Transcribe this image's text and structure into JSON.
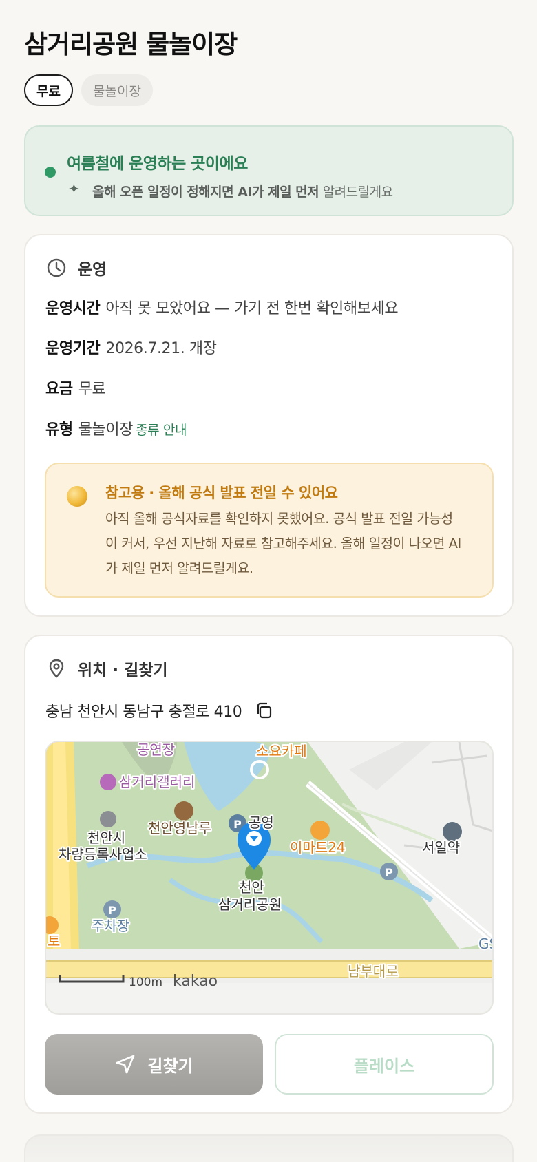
{
  "header": {
    "title": "삼거리공원 물놀이장"
  },
  "tags": {
    "price": "무료",
    "type": "물놀이장"
  },
  "notice": {
    "title": "여름철에 운영하는 곳이에요",
    "sub_bold": "올해 오픈 일정이 정해지면 AI가 제일 먼저",
    "sub_rest": " 알려드릴게요",
    "accent_color": "#2b7f55"
  },
  "operation": {
    "section_title": "운영",
    "hours_label": "운영시간",
    "hours_value": "아직 못 모았어요 — 가기 전 한번 확인해보세요",
    "period_label": "운영기간",
    "period_value": "2026.7.21. 개장",
    "fee_label": "요금",
    "fee_value": "무료",
    "type_label": "유형",
    "type_value": "물놀이장",
    "type_link": "종류 안내",
    "warning": {
      "title": "참고용 · 올해 공식 발표 전일 수 있어요",
      "body": "아직 올해 공식자료를 확인하지 못했어요. 공식 발표 전일 가능성이 커서, 우선 지난해 자료로 참고해주세요. 올해 일정이 나오면 AI가 제일 먼저 알려드릴게요."
    }
  },
  "location": {
    "section_title": "위치 · 길찾기",
    "address": "충남 천안시 동남구 충절로 410",
    "map": {
      "labels": {
        "theater": "공연장",
        "cafe": "소요카페",
        "gallery": "삼거리갤러리",
        "pavilion": "천안영남루",
        "registry_1": "천안시",
        "registry_2": "차량등록사업소",
        "park_label": "공영",
        "mart": "이마트24",
        "pharmacy": "서일약",
        "park_1": "천안",
        "park_2": "삼거리공원",
        "parking": "주차장",
        "road": "남부대로",
        "edge_left": "토",
        "edge_right": "GS",
        "scale": "100m",
        "brand": "kakao"
      }
    },
    "route_button": "길찾기",
    "place_button": "플레이스"
  }
}
